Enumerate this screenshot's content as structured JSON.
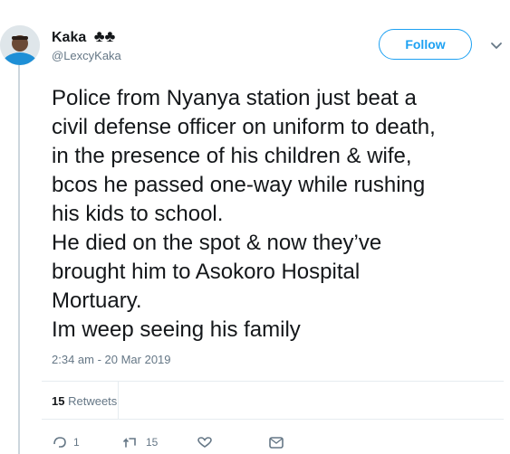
{
  "user": {
    "display_name": "Kaka",
    "emoji": "♣♣",
    "handle": "@LexcyKaka",
    "avatar": "profile-photo"
  },
  "header": {
    "follow_label": "Follow",
    "menu_icon": "chevron-down-icon"
  },
  "tweet": {
    "text": "Police from Nyanya station just beat a\ncivil defense officer on uniform to death,\nin the presence of his children & wife,\nbcos he passed one-way while rushing\nhis kids to school.\nHe died on the spot & now they’ve\nbrought him to Asokoro Hospital\nMortuary.\nIm weep seeing his family",
    "timestamp": "2:34 am - 20 Mar 2019"
  },
  "stats": {
    "retweets_count": "15",
    "retweets_label": "Retweets"
  },
  "actions": {
    "reply_count": "1",
    "retweet_count": "15",
    "like_count": "",
    "icons": [
      "reply-icon",
      "retweet-icon",
      "like-icon",
      "message-icon"
    ]
  },
  "colors": {
    "accent": "#1da1f2",
    "secondary_text": "#657786",
    "primary_text": "#14171a",
    "divider": "#e6ecf0"
  }
}
